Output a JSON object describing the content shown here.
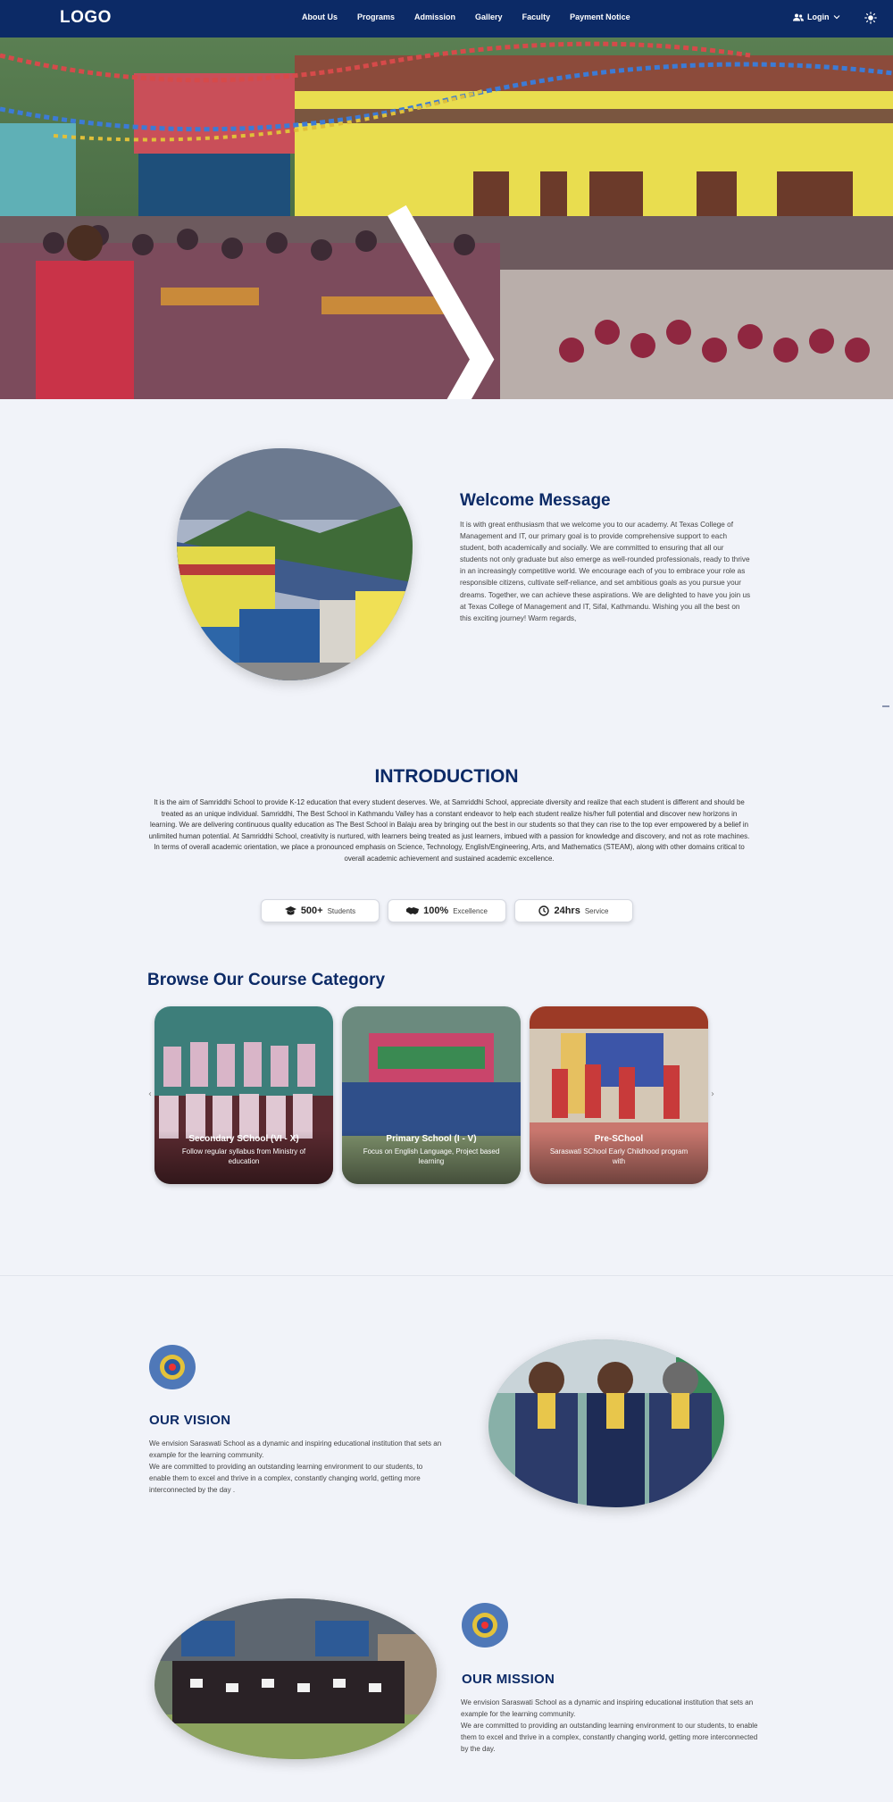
{
  "nav": {
    "logo": "LOGO",
    "links": [
      "About Us",
      "Programs",
      "Admission",
      "Gallery",
      "Faculty",
      "Payment Notice"
    ],
    "login": "Login"
  },
  "welcome": {
    "title": "Welcome Message",
    "text": "It is with great enthusiasm that we welcome you to our academy. At Texas College of Management and IT, our primary goal is to provide comprehensive support to each student, both academically and socially. We are committed to ensuring that all our students not only graduate but also emerge as well-rounded professionals, ready to thrive in an increasingly competitive world. We encourage each of you to embrace your role as responsible citizens, cultivate self-reliance, and set ambitious goals as you pursue your dreams. Together, we can achieve these aspirations. We are delighted to have you join us at Texas College of Management and IT, Sifal, Kathmandu. Wishing you all the best on this exciting journey! Warm regards,"
  },
  "intro": {
    "title": "INTRODUCTION",
    "text": "It is the aim of Samriddhi School to provide K-12 education that every student deserves. We, at Samriddhi School, appreciate diversity and realize that each student is different and should be treated as an unique individual. Samriddhi, The Best School in Kathmandu Valley has a constant endeavor to help each student realize his/her full potential and discover new horizons in learning. We are delivering continuous quality education as The Best School in Balaju area by bringing out the best in our students so that they can rise to the top ever empowered by a belief in unlimited human potential. At Samriddhi School, creativity is nurtured, with learners being treated as just learners, imbued with a passion for knowledge and discovery, and not as rote machines. In terms of overall academic orientation, we place a pronounced emphasis on Science, Technology, English/Engineering, Arts, and Mathematics (STEAM), along with other domains critical to overall academic achievement and sustained academic excellence.",
    "stats": [
      {
        "icon": "graduation-cap-icon",
        "value": "500+",
        "label": "Students"
      },
      {
        "icon": "handshake-icon",
        "value": "100%",
        "label": "Excellence"
      },
      {
        "icon": "clock-icon",
        "value": "24hrs",
        "label": "Service"
      }
    ]
  },
  "courses": {
    "title": "Browse Our Course Category",
    "cards": [
      {
        "title": "Secondary SChool (VI - X)",
        "desc": "Follow regular syllabus from Ministry of education"
      },
      {
        "title": "Primary School (I - V)",
        "desc": "Focus on English Language, Project based learning"
      },
      {
        "title": "Pre-SChool",
        "desc": "Saraswati SChool Early Childhood program with"
      }
    ]
  },
  "vision": {
    "title": "OUR VISION",
    "lines": [
      "We envision Saraswati School as a dynamic and inspiring educational institution that sets an example for the learning community.",
      "We are committed to providing an outstanding learning environment to our students, to enable them to excel and thrive in a complex, constantly changing world, getting more interconnected by the day ."
    ]
  },
  "mission": {
    "title": "OUR MISSION",
    "lines": [
      "We envision Saraswati School as a dynamic and inspiring educational institution that sets an example for the learning community.",
      "We are committed to providing an outstanding learning environment to our students, to enable them to excel and thrive in a complex, constantly changing world, getting more interconnected by the day."
    ]
  },
  "colors": {
    "brand": "#0c2a66",
    "background": "#f1f3f9"
  }
}
